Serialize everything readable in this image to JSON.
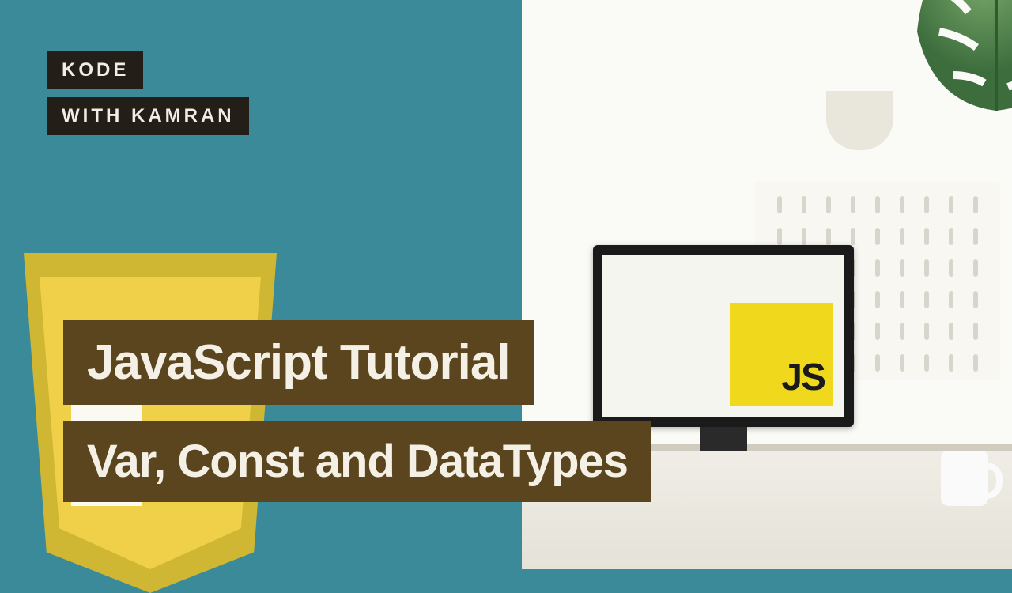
{
  "brand": {
    "line1": "KODE",
    "line2": "WITH KAMRAN"
  },
  "title": {
    "main": "JavaScript Tutorial",
    "sub": "Var, Const and DataTypes"
  },
  "js_logo_text": "JS",
  "colors": {
    "teal": "#3b8a9a",
    "brown": "#5a451f",
    "js_yellow": "#f0d91d",
    "shield_dark": "#d0b733",
    "shield_light": "#f0d048",
    "black": "#231f18"
  }
}
